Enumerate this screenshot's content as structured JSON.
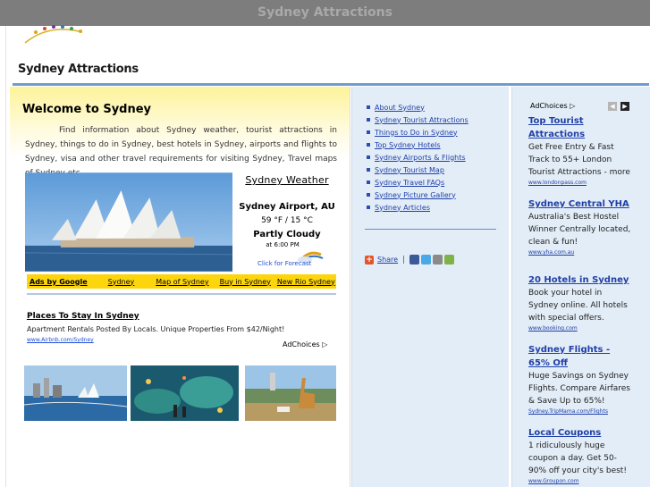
{
  "window": {
    "title": "Sydney Attractions"
  },
  "logo": {
    "text": "Sydney Attractions"
  },
  "welcome": {
    "title": "Welcome to Sydney",
    "intro": "Find information about Sydney weather, tourist attractions in Sydney, things to do in Sydney, best hotels in Sydney, airports and flights to Sydney, visa and other travel requirements for visiting Sydney, Travel maps of Sydney etc."
  },
  "weather": {
    "title": "Sydney Weather",
    "location": "Sydney Airport, AU",
    "temperature": "59 °F / 15 °C",
    "condition": "Partly Cloudy",
    "time": "at 6:00 PM",
    "forecast_link": "Click for Forecast",
    "icon": "partly-cloudy-icon"
  },
  "ad_links": [
    {
      "label": "Ads by Google"
    },
    {
      "label": "Sydney"
    },
    {
      "label": "Map of Sydney"
    },
    {
      "label": "Buy in Sydney"
    },
    {
      "label": "New Rio Sydney"
    }
  ],
  "left_ad": {
    "title": "Places To Stay In Sydney",
    "description": "Apartment Rentals Posted By Locals. Unique Properties From $42/Night!",
    "url": "www.Airbnb.com/Sydney",
    "adchoices": "AdChoices"
  },
  "nav": {
    "items": [
      {
        "label": "About Sydney"
      },
      {
        "label": "Sydney Tourist Attractions"
      },
      {
        "label": "Things to Do in Sydney"
      },
      {
        "label": "Top Sydney Hotels"
      },
      {
        "label": "Sydney Airports & Flights"
      },
      {
        "label": "Sydney Tourist Map"
      },
      {
        "label": "Sydney Travel FAQs"
      },
      {
        "label": "Sydney Picture Gallery"
      },
      {
        "label": "Sydney Articles"
      }
    ]
  },
  "share": {
    "label": "Share",
    "separator": "|"
  },
  "right_ads": {
    "adchoices": "AdChoices",
    "items": [
      {
        "title": "Top Tourist Attractions",
        "description": "Get Free Entry & Fast Track to 55+ London Tourist Attractions - more",
        "url": "www.londonpass.com"
      },
      {
        "title": "Sydney Central YHA",
        "description": "Australia's Best Hostel Winner Centrally located, clean & fun!",
        "url": "www.yha.com.au"
      },
      {
        "title": "20 Hotels in Sydney",
        "description": "Book your hotel in Sydney online. All hotels with special offers.",
        "url": "www.booking.com"
      },
      {
        "title": "Sydney Flights - 65% Off",
        "description": "Huge Savings on Sydney Flights. Compare Airfares & Save Up to 65%!",
        "url": "Sydney.TripMama.com/Flights"
      },
      {
        "title": "Local Coupons",
        "description": "1 ridiculously huge coupon a day. Get 50-90% off your city's best!",
        "url": "www.Groupon.com"
      }
    ]
  },
  "colors": {
    "topbar": "#7d7d7d",
    "accent_blue": "#6e9bd0",
    "link_blue": "#1f3fa8",
    "ad_strip_yellow": "#fcd50c",
    "sidebar_bg": "#e3edf7"
  }
}
